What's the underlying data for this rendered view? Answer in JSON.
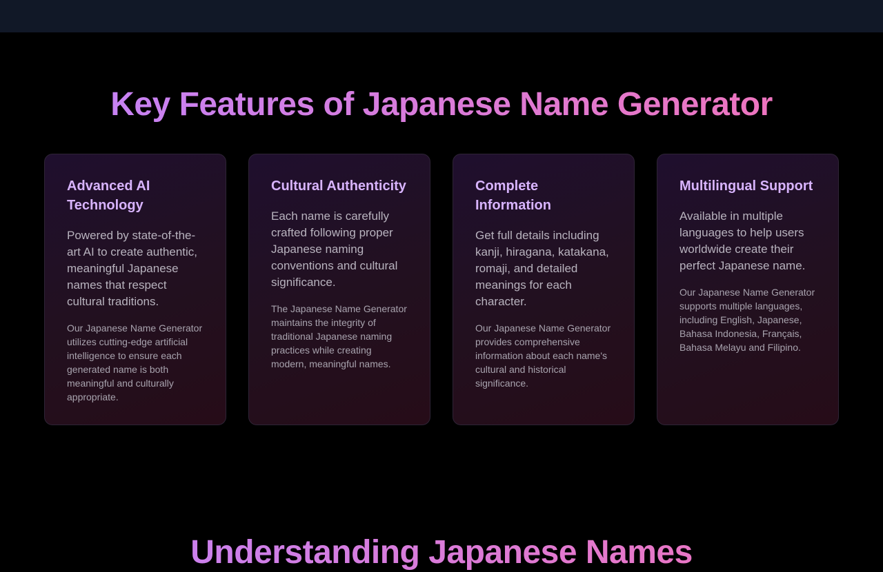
{
  "features": {
    "title": "Key Features of Japanese Name Generator",
    "cards": [
      {
        "title": "Advanced AI Technology",
        "description": "Powered by state-of-the-art AI to create authentic, meaningful Japanese names that respect cultural traditions.",
        "detail": "Our Japanese Name Generator utilizes cutting-edge artificial intelligence to ensure each generated name is both meaningful and culturally appropriate."
      },
      {
        "title": "Cultural Authenticity",
        "description": "Each name is carefully crafted following proper Japanese naming conventions and cultural significance.",
        "detail": "The Japanese Name Generator maintains the integrity of traditional Japanese naming practices while creating modern, meaningful names."
      },
      {
        "title": "Complete Information",
        "description": "Get full details including kanji, hiragana, katakana, romaji, and detailed meanings for each character.",
        "detail": "Our Japanese Name Generator provides comprehensive information about each name's cultural and historical significance."
      },
      {
        "title": "Multilingual Support",
        "description": "Available in multiple languages to help users worldwide create their perfect Japanese name.",
        "detail": "Our Japanese Name Generator supports multiple languages, including English, Japanese, Bahasa Indonesia, Français, Bahasa Melayu and Filipino."
      }
    ]
  },
  "understanding": {
    "title": "Understanding Japanese Names"
  },
  "colors": {
    "background": "#000000",
    "header": "#111827",
    "gradient_start": "#c084fc",
    "gradient_end": "#f472b6",
    "card_title": "#d8b4fe"
  }
}
